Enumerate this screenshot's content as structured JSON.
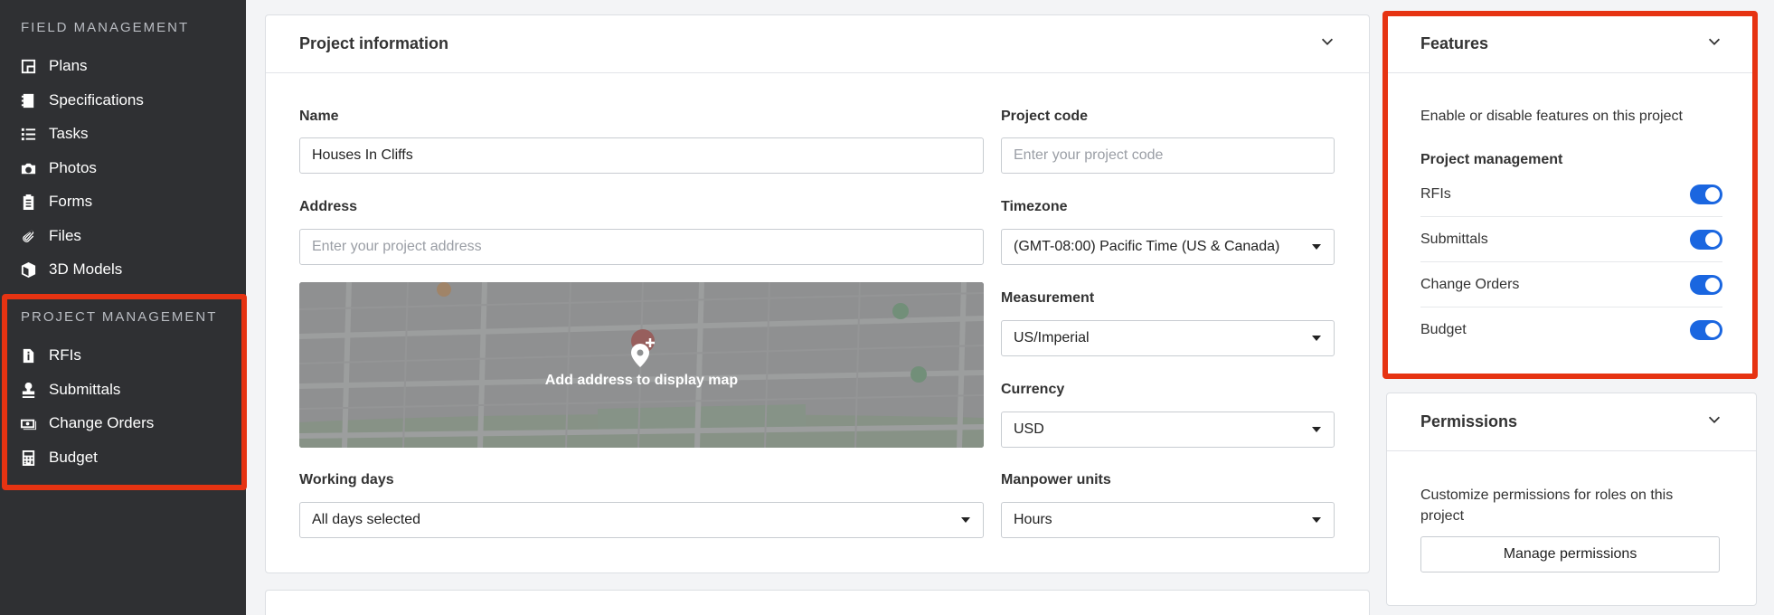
{
  "sidebar": {
    "field_management_header": "FIELD MANAGEMENT",
    "field_items": [
      {
        "label": "Plans",
        "icon": "plans-icon"
      },
      {
        "label": "Specifications",
        "icon": "specifications-icon"
      },
      {
        "label": "Tasks",
        "icon": "tasks-icon"
      },
      {
        "label": "Photos",
        "icon": "camera-icon"
      },
      {
        "label": "Forms",
        "icon": "clipboard-icon"
      },
      {
        "label": "Files",
        "icon": "paperclip-icon"
      },
      {
        "label": "3D Models",
        "icon": "cube-icon"
      }
    ],
    "project_management_header": "PROJECT MANAGEMENT",
    "project_items": [
      {
        "label": "RFIs",
        "icon": "rfi-icon"
      },
      {
        "label": "Submittals",
        "icon": "stamp-icon"
      },
      {
        "label": "Change Orders",
        "icon": "money-icon"
      },
      {
        "label": "Budget",
        "icon": "calculator-icon"
      }
    ]
  },
  "project_info": {
    "title": "Project information",
    "name_label": "Name",
    "name_value": "Houses In Cliffs",
    "code_label": "Project code",
    "code_placeholder": "Enter your project code",
    "address_label": "Address",
    "address_placeholder": "Enter your project address",
    "map_text": "Add address to display map",
    "timezone_label": "Timezone",
    "timezone_value": "(GMT-08:00) Pacific Time (US & Canada)",
    "measurement_label": "Measurement",
    "measurement_value": "US/Imperial",
    "currency_label": "Currency",
    "currency_value": "USD",
    "working_days_label": "Working days",
    "working_days_value": "All days selected",
    "manpower_label": "Manpower units",
    "manpower_value": "Hours"
  },
  "features": {
    "title": "Features",
    "description": "Enable or disable features on this project",
    "subheader": "Project management",
    "items": [
      {
        "label": "RFIs",
        "enabled": true
      },
      {
        "label": "Submittals",
        "enabled": true
      },
      {
        "label": "Change Orders",
        "enabled": true
      },
      {
        "label": "Budget",
        "enabled": true
      }
    ]
  },
  "permissions": {
    "title": "Permissions",
    "description": "Customize permissions for roles on this project",
    "button_label": "Manage permissions"
  },
  "colors": {
    "sidebar_bg": "#2f3033",
    "highlight": "#e63312",
    "toggle_on": "#1a66e0"
  }
}
